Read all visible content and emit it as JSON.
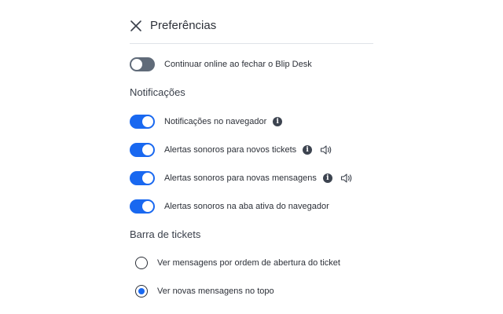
{
  "header": {
    "title": "Preferências"
  },
  "general": {
    "online_label": "Continuar online ao fechar o Blip Desk",
    "online_enabled": false
  },
  "notifications": {
    "title": "Notificações",
    "items": [
      {
        "label": "Notificações no navegador",
        "enabled": true,
        "info_icon": "info-icon"
      },
      {
        "label": "Alertas sonoros para novos tickets",
        "enabled": true,
        "info_icon": "info-icon",
        "sound_icon": "speaker-icon"
      },
      {
        "label": "Alertas sonoros para novas mensagens",
        "enabled": true,
        "info_icon": "info-icon",
        "sound_icon": "speaker-icon"
      },
      {
        "label": "Alertas sonoros na aba ativa do navegador",
        "enabled": true
      }
    ]
  },
  "tickets_bar": {
    "title": "Barra de tickets",
    "options": [
      {
        "label": "Ver mensagens por ordem de abertura do ticket",
        "selected": false
      },
      {
        "label": "Ver novas mensagens no topo",
        "selected": true
      }
    ]
  },
  "colors": {
    "toggle_on": "#1968f0",
    "toggle_off": "#606b79",
    "text": "#2c3038"
  }
}
